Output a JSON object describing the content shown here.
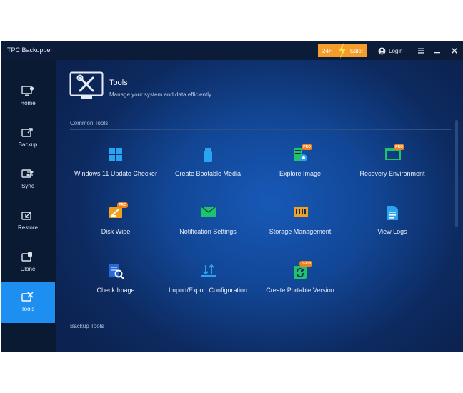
{
  "app": {
    "title": "TPC Backupper"
  },
  "titlebar": {
    "sale_24h": "24H",
    "sale_label": "Sale!",
    "login_label": "Login"
  },
  "sidebar": {
    "items": [
      {
        "label": "Home",
        "icon": "home-icon"
      },
      {
        "label": "Backup",
        "icon": "backup-icon"
      },
      {
        "label": "Sync",
        "icon": "sync-icon"
      },
      {
        "label": "Restore",
        "icon": "restore-icon"
      },
      {
        "label": "Clone",
        "icon": "clone-icon"
      },
      {
        "label": "Tools",
        "icon": "tools-icon",
        "active": true
      }
    ]
  },
  "page": {
    "title": "Tools",
    "subtitle": "Manage your system and data efficiently."
  },
  "sections": {
    "common": "Common Tools",
    "backup": "Backup Tools"
  },
  "tools": [
    {
      "label": "Windows 11 Update Checker",
      "icon": "windows-icon"
    },
    {
      "label": "Create Bootable Media",
      "icon": "usb-drive-icon"
    },
    {
      "label": "Explore Image",
      "icon": "explore-image-icon",
      "badge": "PRO"
    },
    {
      "label": "Recovery Environment",
      "icon": "recovery-environment-icon",
      "badge": "PRO"
    },
    {
      "label": "Disk Wipe",
      "icon": "disk-wipe-icon",
      "badge": "PRO"
    },
    {
      "label": "Notification Settings",
      "icon": "mail-icon"
    },
    {
      "label": "Storage Management",
      "icon": "storage-icon"
    },
    {
      "label": "View Logs",
      "icon": "log-file-icon"
    },
    {
      "label": "Check Image",
      "icon": "check-image-icon"
    },
    {
      "label": "Import/Export Configuration",
      "icon": "import-export-icon"
    },
    {
      "label": "Create Portable Version",
      "icon": "portable-version-icon",
      "badge": "TECH"
    }
  ],
  "colors": {
    "accent": "#1d8ff0",
    "sale": "#f59d2a",
    "icon_green": "#1fc36b",
    "icon_blue": "#2aa4f0",
    "icon_orange": "#f0a020"
  }
}
